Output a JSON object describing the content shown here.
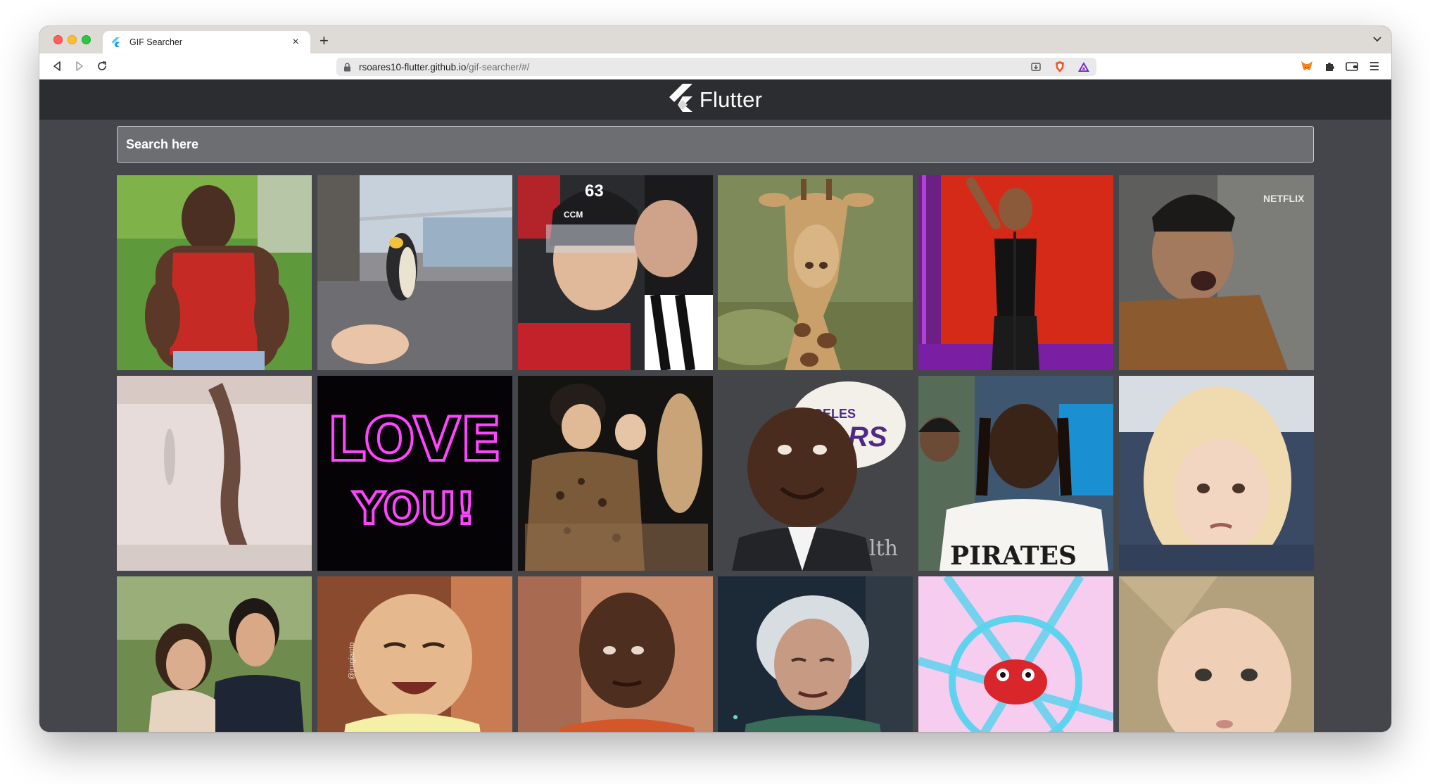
{
  "browser": {
    "tab": {
      "title": "GIF Searcher",
      "favicon": "flutter-icon",
      "close": "×"
    },
    "new_tab": "+",
    "tabs_menu": "⌄",
    "address": {
      "host": "rsoares10-flutter.github.io",
      "path": "/gif-searcher/#/"
    },
    "extensions": [
      "metamask-icon",
      "puzzle-icon",
      "wallet-icon",
      "menu-icon"
    ],
    "address_icons": [
      "install-icon",
      "brave-shields-icon",
      "brave-rewards-icon"
    ]
  },
  "app": {
    "brand": "Flutter",
    "search": {
      "placeholder": "Search here",
      "value": ""
    },
    "gifs": [
      {
        "name": "woman-red-tank-top"
      },
      {
        "name": "penguin-on-balcony"
      },
      {
        "name": "hockey-player-referee",
        "jersey": "63",
        "sticker": "CCM"
      },
      {
        "name": "giraffe-closeup"
      },
      {
        "name": "woman-red-stage"
      },
      {
        "name": "man-screaming-car",
        "watermark": "NETFLIX"
      },
      {
        "name": "rat-bathtub"
      },
      {
        "name": "love-you-neon",
        "line1": "LOVE",
        "line2": "YOU!"
      },
      {
        "name": "women-leopard-print"
      },
      {
        "name": "man-lakers-smiling",
        "logo": "GELES",
        "logo2": "RS",
        "tag": "lth"
      },
      {
        "name": "pirates-player",
        "jersey": "PIRATES"
      },
      {
        "name": "side-eye-toddler"
      },
      {
        "name": "couple-smiling"
      },
      {
        "name": "laughing-child",
        "credit": "@jrugianto"
      },
      {
        "name": "man-orange-shirt"
      },
      {
        "name": "old-woman-cackling"
      },
      {
        "name": "cartoon-frog-target"
      },
      {
        "name": "surprised-baby"
      }
    ]
  }
}
